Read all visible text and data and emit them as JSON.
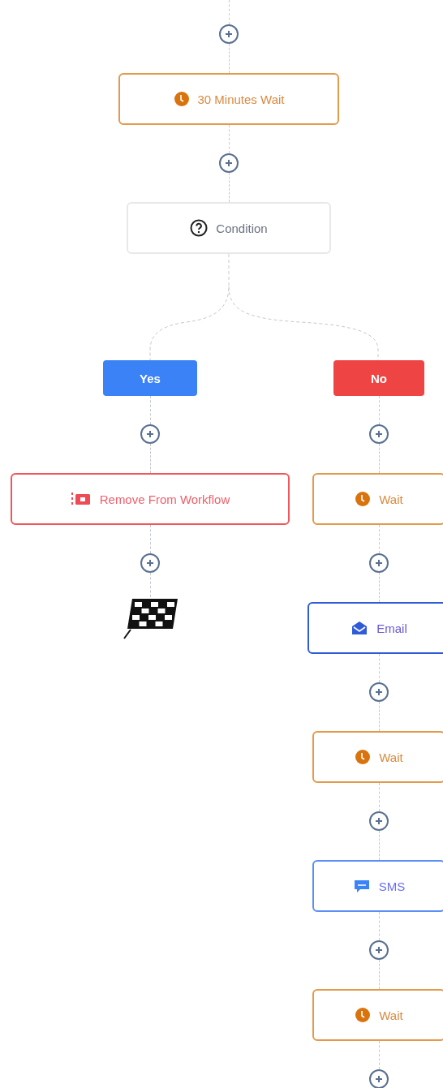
{
  "trunk": [
    {
      "kind": "add"
    },
    {
      "kind": "wait",
      "label": "30 Minutes Wait"
    },
    {
      "kind": "add"
    },
    {
      "kind": "condition",
      "label": "Condition"
    }
  ],
  "branches": [
    {
      "label": "Yes",
      "kind": "yes",
      "steps": [
        {
          "kind": "add"
        },
        {
          "kind": "remove",
          "label": "Remove From Workflow"
        },
        {
          "kind": "add"
        },
        {
          "kind": "end"
        }
      ]
    },
    {
      "label": "No",
      "kind": "no",
      "steps": [
        {
          "kind": "add"
        },
        {
          "kind": "wait",
          "label": "Wait"
        },
        {
          "kind": "add"
        },
        {
          "kind": "email",
          "label": "Email"
        },
        {
          "kind": "add"
        },
        {
          "kind": "wait",
          "label": "Wait"
        },
        {
          "kind": "add"
        },
        {
          "kind": "sms",
          "label": "SMS"
        },
        {
          "kind": "add"
        },
        {
          "kind": "wait",
          "label": "Wait"
        },
        {
          "kind": "add"
        }
      ]
    }
  ]
}
